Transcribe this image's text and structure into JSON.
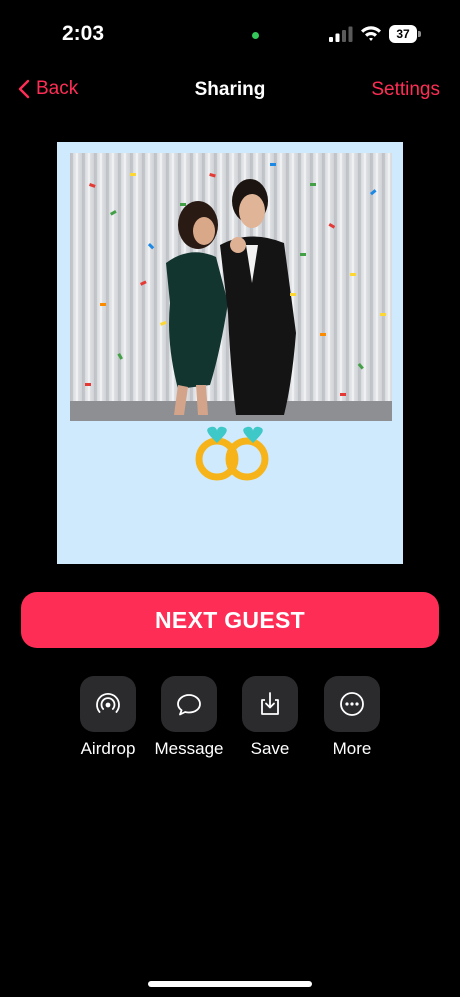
{
  "status_bar": {
    "time": "2:03",
    "battery": "37"
  },
  "nav": {
    "back_label": "Back",
    "title": "Sharing",
    "settings_label": "Settings"
  },
  "photo": {
    "background_color": "#cfeafd"
  },
  "next_button": {
    "label": "NEXT GUEST"
  },
  "actions": [
    {
      "label": "Airdrop",
      "icon": "airdrop-icon"
    },
    {
      "label": "Message",
      "icon": "message-icon"
    },
    {
      "label": "Save",
      "icon": "save-icon"
    },
    {
      "label": "More",
      "icon": "more-icon"
    }
  ],
  "colors": {
    "accent": "#ff2d55",
    "button": "#fd2d55",
    "tile": "#2b2b2e"
  }
}
